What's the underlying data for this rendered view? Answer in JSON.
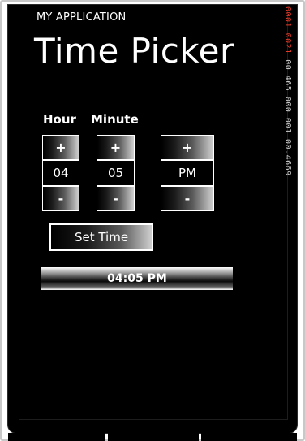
{
  "app": {
    "name": "MY APPLICATION",
    "page_title": "Time Picker"
  },
  "picker": {
    "hour_label": "Hour",
    "minute_label": "Minute",
    "hour": {
      "increment": "+",
      "value": "04",
      "decrement": "-"
    },
    "minute": {
      "increment": "+",
      "value": "05",
      "decrement": "-"
    },
    "ampm": {
      "increment": "+",
      "value": "PM",
      "decrement": "-"
    }
  },
  "actions": {
    "set_time_label": "Set Time"
  },
  "result": {
    "time_text": "04:05 PM"
  },
  "frame_counter": {
    "red_part": "0001 0021",
    "white_part": " 00 465 000 001 00.4669"
  },
  "colors": {
    "background": "#000000",
    "text": "#ffffff",
    "counter_red": "#e03c2a"
  }
}
